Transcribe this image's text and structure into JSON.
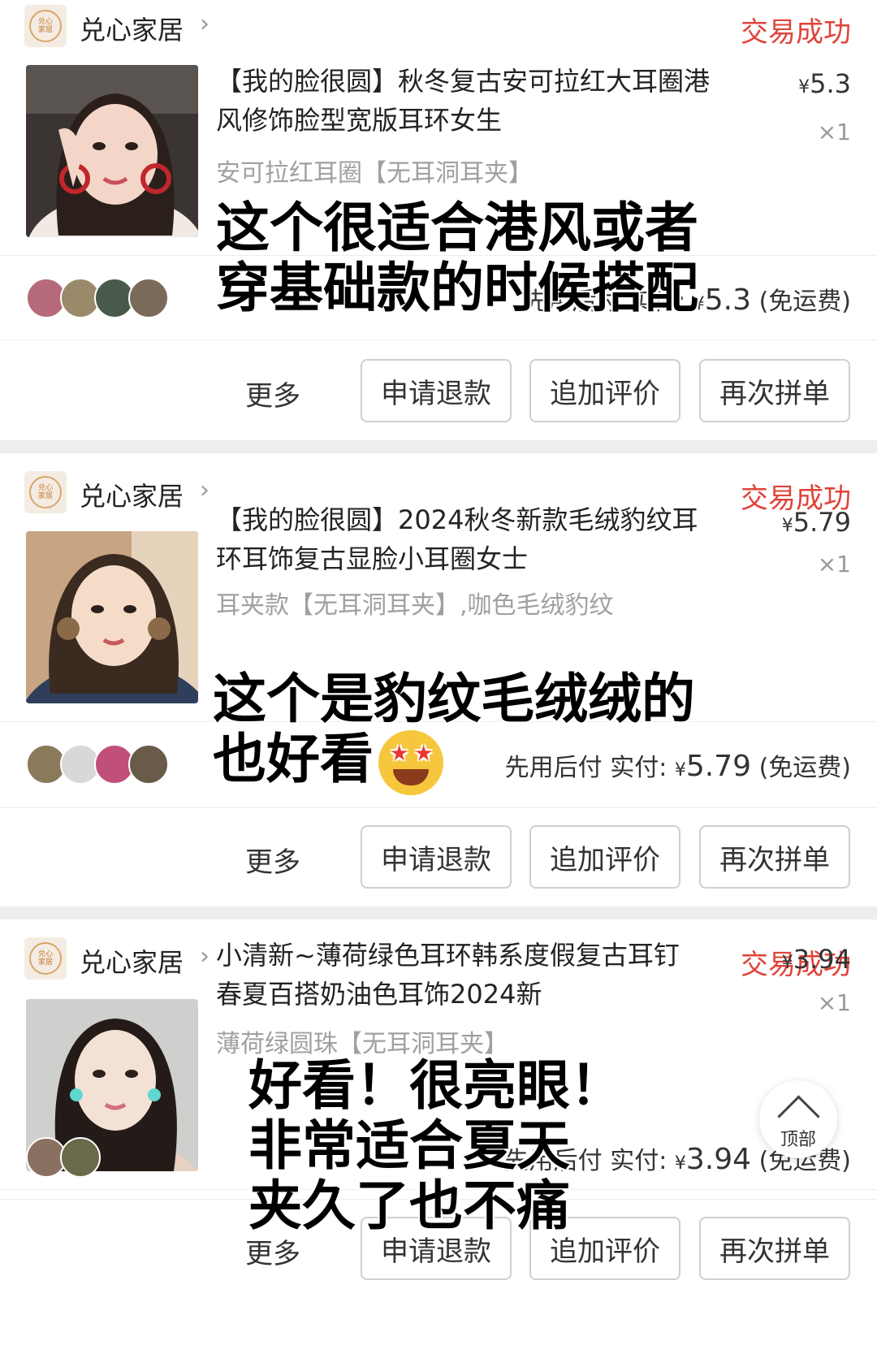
{
  "orders": [
    {
      "shop_name": "兑心家居",
      "shop_logo_text": "兑心家居",
      "status": "交易成功",
      "title_line1": "【我的脸很圆】秋冬复古安可拉红大耳圈港",
      "title_line2": "风修饰脸型宽版耳环女生",
      "sku": "安可拉红耳圈【无耳洞耳夹】",
      "price": "5.3",
      "qty": "×1",
      "pay_label": "先用后付 实付:",
      "pay_amount": "5.3",
      "shipping": "(免运费)",
      "more": "更多",
      "btn_refund": "申请退款",
      "btn_review": "追加评价",
      "btn_reorder": "再次拼单",
      "note_line1": "这个很适合港风或者",
      "note_line2": "穿基础款的时候搭配"
    },
    {
      "shop_name": "兑心家居",
      "shop_logo_text": "兑心家居",
      "status": "交易成功",
      "title_line1": "【我的脸很圆】2024秋冬新款毛绒豹纹耳",
      "title_line2": "环耳饰复古显脸小耳圈女士",
      "sku": "耳夹款【无耳洞耳夹】,咖色毛绒豹纹",
      "price": "5.79",
      "qty": "×1",
      "pay_label": "先用后付 实付:",
      "pay_amount": "5.79",
      "shipping": "(免运费)",
      "more": "更多",
      "btn_refund": "申请退款",
      "btn_review": "追加评价",
      "btn_reorder": "再次拼单",
      "note_line1": "这个是豹纹毛绒绒的",
      "note_line2": "也好看"
    },
    {
      "shop_name": "兑心家居",
      "shop_logo_text": "兑心家居",
      "status": "交易成功",
      "title_line1": "小清新~薄荷绿色耳环韩系度假复古耳钉",
      "title_line2": "春夏百搭奶油色耳饰2024新",
      "sku": "薄荷绿圆珠【无耳洞耳夹】",
      "price": "3.94",
      "qty": "×1",
      "pay_label": "先用后付 实付:",
      "pay_amount": "3.94",
      "shipping": "(免运费)",
      "more": "更多",
      "btn_refund": "申请退款",
      "btn_review": "追加评价",
      "btn_reorder": "再次拼单",
      "note_line1": "好看！很亮眼！",
      "note_line2": "非常适合夏天",
      "note_line3": "夹久了也不痛"
    }
  ],
  "currency": "¥",
  "top_button_label": "顶部",
  "colors": {
    "status_red": "#e0433a",
    "separator": "#eeeeee"
  }
}
